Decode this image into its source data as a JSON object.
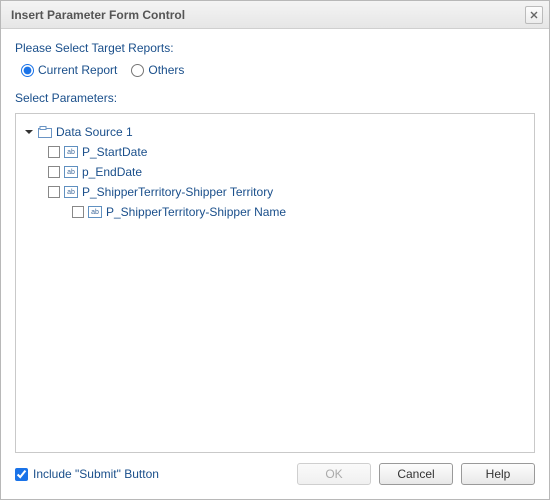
{
  "title": "Insert Parameter Form Control",
  "sections": {
    "target_label": "Please Select Target Reports:",
    "params_label": "Select Parameters:"
  },
  "radios": {
    "current": "Current Report",
    "others": "Others",
    "selected": "current"
  },
  "tree": {
    "root_label": "Data Source 1",
    "params": [
      {
        "label": "P_StartDate"
      },
      {
        "label": "p_EndDate"
      },
      {
        "label": "P_ShipperTerritory-Shipper Territory"
      }
    ],
    "nested_param": {
      "label": "P_ShipperTerritory-Shipper Name"
    }
  },
  "param_icon_text": "ab",
  "include_submit": {
    "label": "Include \"Submit\" Button",
    "checked": true
  },
  "buttons": {
    "ok": "OK",
    "cancel": "Cancel",
    "help": "Help"
  }
}
